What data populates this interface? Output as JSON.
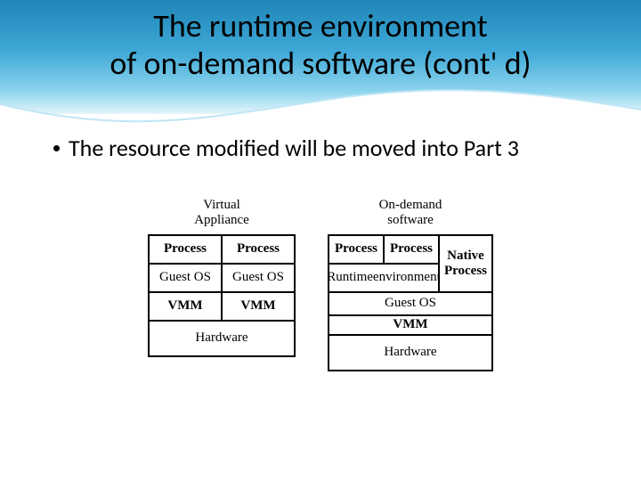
{
  "title": {
    "line1": "The runtime environment",
    "line2": "of on-demand software (cont' d)"
  },
  "bullet1": "The resource modified will be moved into Part 3",
  "fig": {
    "left": {
      "title_l1": "Virtual",
      "title_l2": "Appliance",
      "r1a": "Process",
      "r1b": "Process",
      "r2a": "Guest OS",
      "r2b": "Guest OS",
      "r3a": "VMM",
      "r3b": "VMM",
      "r4": "Hardware"
    },
    "right": {
      "title_l1": "On-demand",
      "title_l2": "software",
      "p1": "Process",
      "p2": "Process",
      "runtime_l1": "Runtime",
      "runtime_l2": "environment",
      "native_l1": "Native",
      "native_l2": "Process",
      "guest": "Guest OS",
      "vmm": "VMM",
      "hw": "Hardware"
    }
  }
}
